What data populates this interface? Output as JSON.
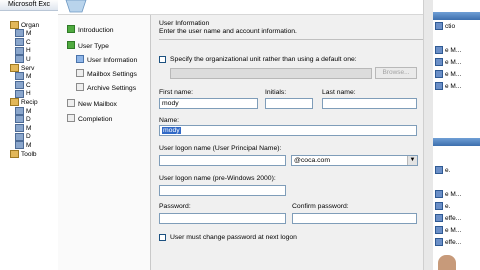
{
  "console": {
    "title": "Microsoft Exc",
    "tree": [
      {
        "label": "Microsoft Exc",
        "indent": 0
      },
      {
        "label": "Organ",
        "indent": 2
      },
      {
        "label": "M",
        "indent": 3
      },
      {
        "label": "C",
        "indent": 3
      },
      {
        "label": "H",
        "indent": 3
      },
      {
        "label": "U",
        "indent": 3
      },
      {
        "label": "Serv",
        "indent": 2
      },
      {
        "label": "M",
        "indent": 3
      },
      {
        "label": "C",
        "indent": 3
      },
      {
        "label": "H",
        "indent": 3
      },
      {
        "label": "Recip",
        "indent": 2
      },
      {
        "label": "M",
        "indent": 3
      },
      {
        "label": "D",
        "indent": 3
      },
      {
        "label": "M",
        "indent": 3
      },
      {
        "label": "D",
        "indent": 3
      },
      {
        "label": "M",
        "indent": 3
      },
      {
        "label": "Toolb",
        "indent": 2
      }
    ],
    "actions": [
      "ctio",
      "",
      "e M...",
      "e M...",
      "e M...",
      "e M...",
      "",
      "",
      "",
      "",
      "",
      "",
      "e.",
      "",
      "e M...",
      "e.",
      "effe...",
      "e M...",
      "effe..."
    ]
  },
  "wizard": {
    "nav": [
      {
        "label": "Introduction",
        "state": "done",
        "sub": false
      },
      {
        "label": "User Type",
        "state": "done",
        "sub": false
      },
      {
        "label": "User Information",
        "state": "current",
        "sub": true
      },
      {
        "label": "Mailbox Settings",
        "state": "pending",
        "sub": true
      },
      {
        "label": "Archive Settings",
        "state": "pending",
        "sub": true
      },
      {
        "label": "New Mailbox",
        "state": "pending",
        "sub": false
      },
      {
        "label": "Completion",
        "state": "pending",
        "sub": false
      }
    ],
    "section_title": "User Information",
    "section_subtitle": "Enter the user name and account information.",
    "ou_checkbox_label": "Specify the organizational unit rather than using a default one:",
    "ou_value": "",
    "browse_label": "Browse...",
    "first_name_label": "First name:",
    "first_name_value": "mody",
    "initials_label": "Initials:",
    "initials_value": "",
    "last_name_label": "Last name:",
    "last_name_value": "",
    "name_label": "Name:",
    "name_value": "mody",
    "logon_label": "User logon name (User Principal Name):",
    "logon_value": "",
    "domain_value": "@coca.com",
    "prewin_label": "User logon name (pre-Windows 2000):",
    "prewin_value": "",
    "password_label": "Password:",
    "confirm_label": "Confirm password:",
    "must_change_label": "User must change password at next logon"
  }
}
